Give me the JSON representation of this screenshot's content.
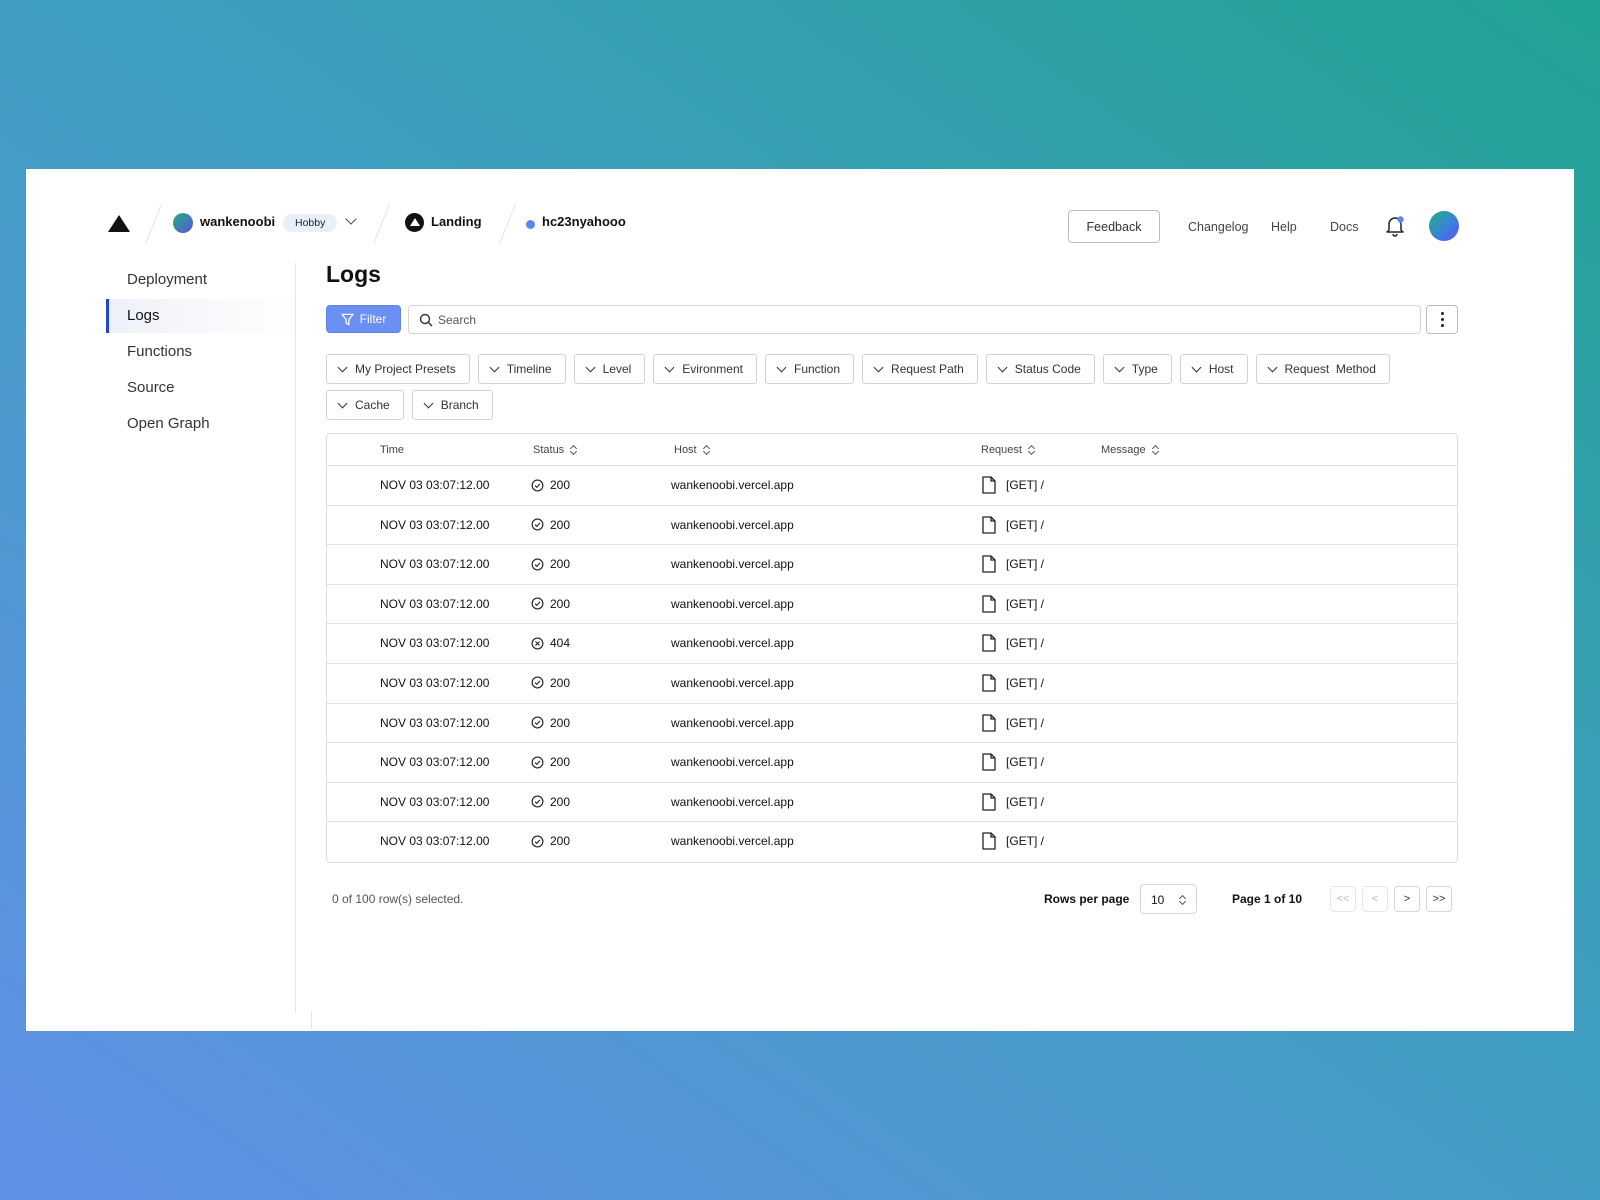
{
  "topbar": {
    "team_name": "wankenoobi",
    "plan": "Hobby",
    "project_name": "Landing",
    "branch_name": "hc23nyahooo",
    "feedback_label": "Feedback",
    "links": [
      "Changelog",
      "Help",
      "Docs"
    ]
  },
  "sidebar": {
    "items": [
      {
        "label": "Deployment",
        "active": false
      },
      {
        "label": "Logs",
        "active": true
      },
      {
        "label": "Functions",
        "active": false
      },
      {
        "label": "Source",
        "active": false
      },
      {
        "label": "Open Graph",
        "active": false
      }
    ]
  },
  "main": {
    "title": "Logs",
    "filter_label": "Filter",
    "search_placeholder": "Search",
    "filter_chips": [
      "My Project Presets",
      "Timeline",
      "Level",
      "Evironment",
      "Function",
      "Request Path",
      "Status Code",
      "Type",
      "Host",
      "Request  Method",
      "Cache",
      "Branch"
    ]
  },
  "table": {
    "columns": [
      "Time",
      "Status",
      "Host",
      "Request",
      "Message"
    ],
    "rows": [
      {
        "time": "NOV 03 03:07:12.00",
        "status": "200",
        "ok": true,
        "host": "wankenoobi.vercel.app",
        "request": "[GET] /",
        "message": ""
      },
      {
        "time": "NOV 03 03:07:12.00",
        "status": "200",
        "ok": true,
        "host": "wankenoobi.vercel.app",
        "request": "[GET] /",
        "message": ""
      },
      {
        "time": "NOV 03 03:07:12.00",
        "status": "200",
        "ok": true,
        "host": "wankenoobi.vercel.app",
        "request": "[GET] /",
        "message": ""
      },
      {
        "time": "NOV 03 03:07:12.00",
        "status": "200",
        "ok": true,
        "host": "wankenoobi.vercel.app",
        "request": "[GET] /",
        "message": ""
      },
      {
        "time": "NOV 03 03:07:12.00",
        "status": "404",
        "ok": false,
        "host": "wankenoobi.vercel.app",
        "request": "[GET] /",
        "message": ""
      },
      {
        "time": "NOV 03 03:07:12.00",
        "status": "200",
        "ok": true,
        "host": "wankenoobi.vercel.app",
        "request": "[GET] /",
        "message": ""
      },
      {
        "time": "NOV 03 03:07:12.00",
        "status": "200",
        "ok": true,
        "host": "wankenoobi.vercel.app",
        "request": "[GET] /",
        "message": ""
      },
      {
        "time": "NOV 03 03:07:12.00",
        "status": "200",
        "ok": true,
        "host": "wankenoobi.vercel.app",
        "request": "[GET] /",
        "message": ""
      },
      {
        "time": "NOV 03 03:07:12.00",
        "status": "200",
        "ok": true,
        "host": "wankenoobi.vercel.app",
        "request": "[GET] /",
        "message": ""
      },
      {
        "time": "NOV 03 03:07:12.00",
        "status": "200",
        "ok": true,
        "host": "wankenoobi.vercel.app",
        "request": "[GET] /",
        "message": ""
      }
    ]
  },
  "footer": {
    "selection_text": "0 of 100 row(s) selected.",
    "rows_per_page_label": "Rows per page",
    "rows_per_page_value": "10",
    "page_text": "Page 1 of 10",
    "pager": [
      "<<",
      "<",
      ">",
      ">>"
    ]
  },
  "colors": {
    "accent": "#6b8ff2",
    "active_indicator": "#2347c9",
    "notification_dot": "#5b86f0"
  },
  "icons": {
    "brand": "triangle-logo-icon",
    "filter": "funnel-icon",
    "search": "search-icon",
    "more": "kebab-menu-icon",
    "notifications": "bell-icon",
    "status_ok": "check-circle-icon",
    "status_error": "x-circle-icon",
    "request": "document-icon",
    "sort": "sort-icon"
  }
}
